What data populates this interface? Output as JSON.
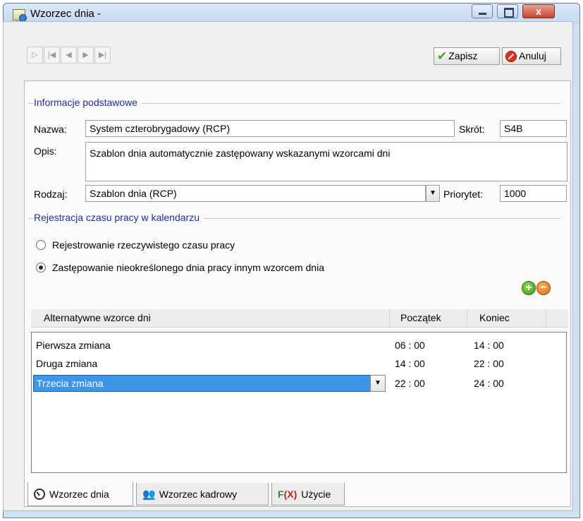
{
  "window": {
    "title": "Wzorzec dnia -",
    "close_glyph": "x"
  },
  "nav": {
    "new": "▷",
    "first": "|◀",
    "prev": "◀",
    "next": "▶",
    "last": "▶|"
  },
  "toolbar": {
    "save_label": "Zapisz",
    "cancel_label": "Anuluj"
  },
  "basic": {
    "section_title": "Informacje podstawowe",
    "name_label": "Nazwa:",
    "name_value": "System czterobrygadowy (RCP)",
    "short_label": "Skrót:",
    "short_value": "S4B",
    "desc_label": "Opis:",
    "desc_value": "Szablon dnia automatycznie zastępowany wskazanymi wzorcami dni",
    "type_label": "Rodzaj:",
    "type_value": "Szablon dnia (RCP)",
    "priority_label": "Priorytet:",
    "priority_value": "1000"
  },
  "registration": {
    "section_title": "Rejestracja czasu pracy w kalendarzu",
    "options": [
      {
        "label": "Rejestrowanie rzeczywistego czasu pracy",
        "selected": false
      },
      {
        "label": "Zastępowanie nieokreślonego dnia pracy innym wzorcem dnia",
        "selected": true
      }
    ],
    "add_glyph": "+",
    "remove_glyph": "−"
  },
  "grid": {
    "columns": [
      "Alternatywne wzorce dni",
      "Początek",
      "Koniec"
    ],
    "rows": [
      {
        "name": "Pierwsza zmiana",
        "start": "06 : 00",
        "end": "14 : 00",
        "selected": false
      },
      {
        "name": "Druga zmiana",
        "start": "14 : 00",
        "end": "22 : 00",
        "selected": false
      },
      {
        "name": "Trzecia zmiana",
        "start": "22 : 00",
        "end": "24 : 00",
        "selected": true
      }
    ]
  },
  "tabs": [
    {
      "label": "Wzorzec dnia",
      "active": true
    },
    {
      "label": "Wzorzec kadrowy",
      "active": false
    },
    {
      "label": "Użycie",
      "active": false
    }
  ],
  "icons": {
    "fx_f": "F",
    "fx_x": "(X)",
    "people": "👥"
  }
}
